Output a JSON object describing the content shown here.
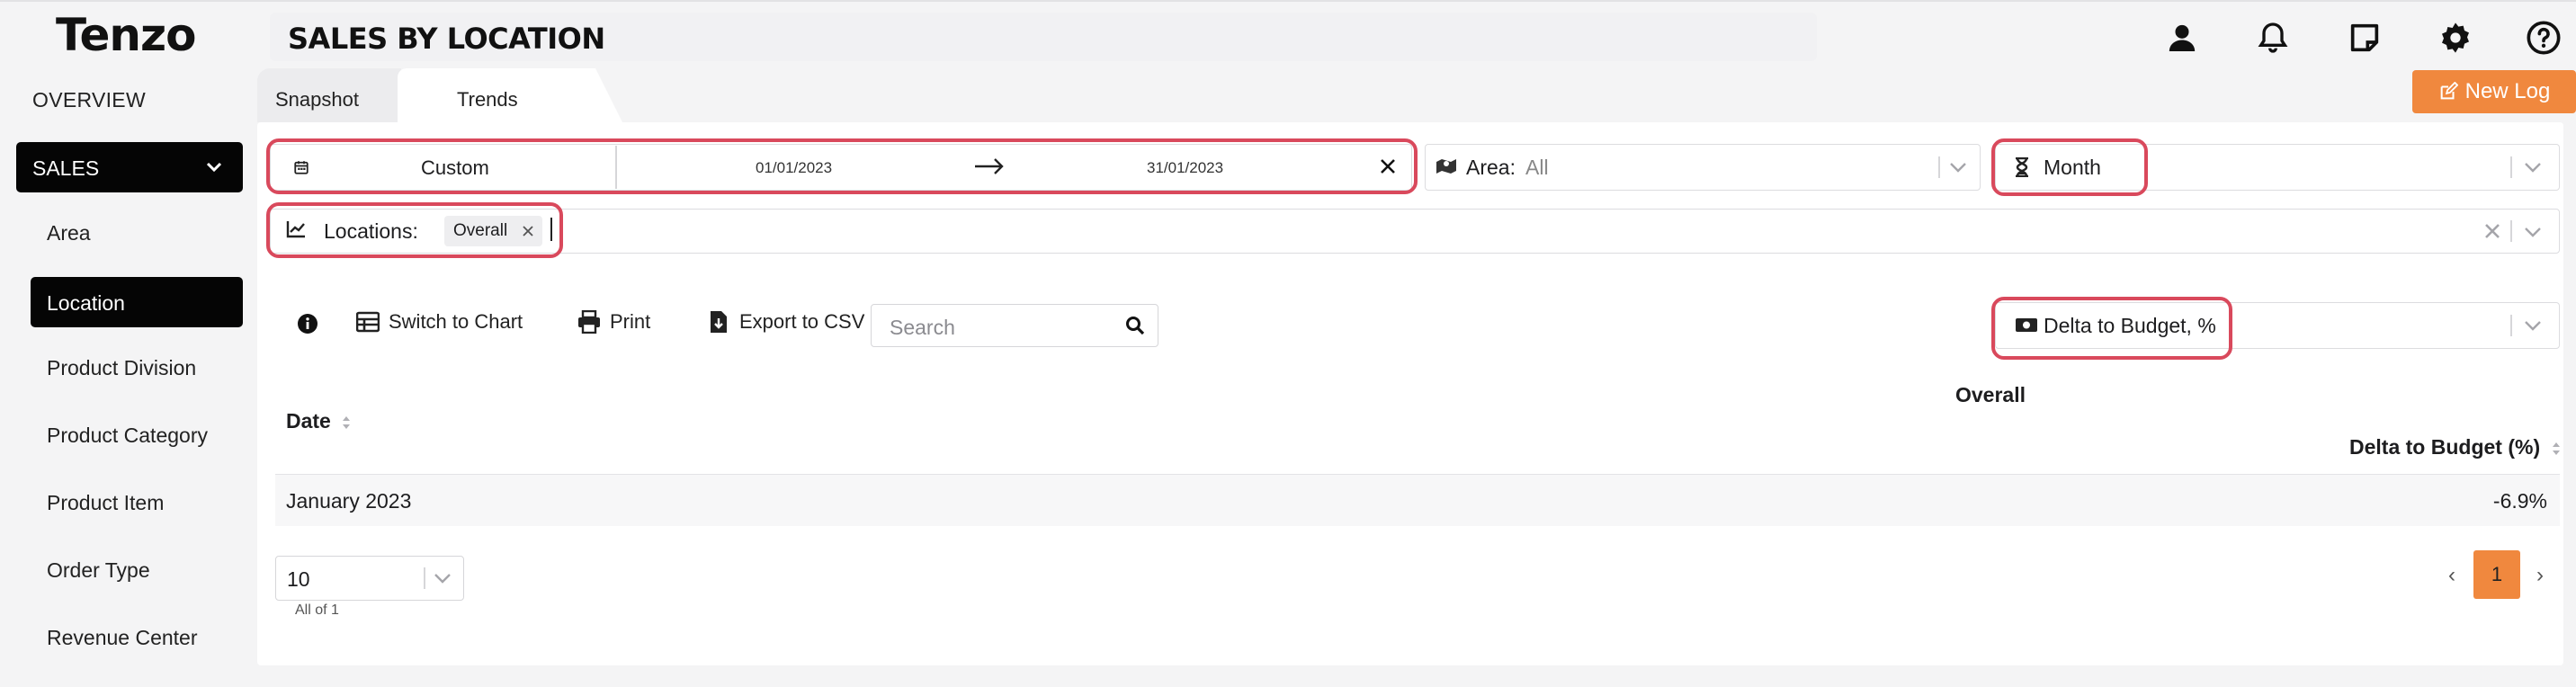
{
  "app": {
    "logo": "Tenzo",
    "page_title": "SALES BY LOCATION"
  },
  "sidebar": {
    "overview": "OVERVIEW",
    "section": "SALES",
    "items": [
      {
        "label": "Area"
      },
      {
        "label": "Location"
      },
      {
        "label": "Product Division"
      },
      {
        "label": "Product Category"
      },
      {
        "label": "Product Item"
      },
      {
        "label": "Order Type"
      },
      {
        "label": "Revenue Center"
      }
    ]
  },
  "tabs": {
    "snapshot": "Snapshot",
    "trends": "Trends"
  },
  "actions": {
    "new_log": "New Log"
  },
  "filters": {
    "date_mode": "Custom",
    "date_start": "01/01/2023",
    "date_end": "31/01/2023",
    "area_label": "Area:",
    "area_value": "All",
    "period": "Month",
    "locations_label": "Locations:",
    "location_tag": "Overall",
    "metric": "Delta to Budget, %"
  },
  "toolbar": {
    "switch_chart": "Switch to Chart",
    "print": "Print",
    "export": "Export to CSV",
    "search_placeholder": "Search"
  },
  "table": {
    "group_header": "Overall",
    "col_date": "Date",
    "col_delta": "Delta to Budget (%)",
    "rows": [
      {
        "date": "January 2023",
        "delta": "-6.9%"
      }
    ]
  },
  "pagination": {
    "page_size": "10",
    "summary": "All of 1",
    "prev": "‹",
    "current": "1",
    "next": "›"
  },
  "colors": {
    "accent": "#f0883e",
    "highlight": "#d9495c",
    "active": "#050505"
  }
}
